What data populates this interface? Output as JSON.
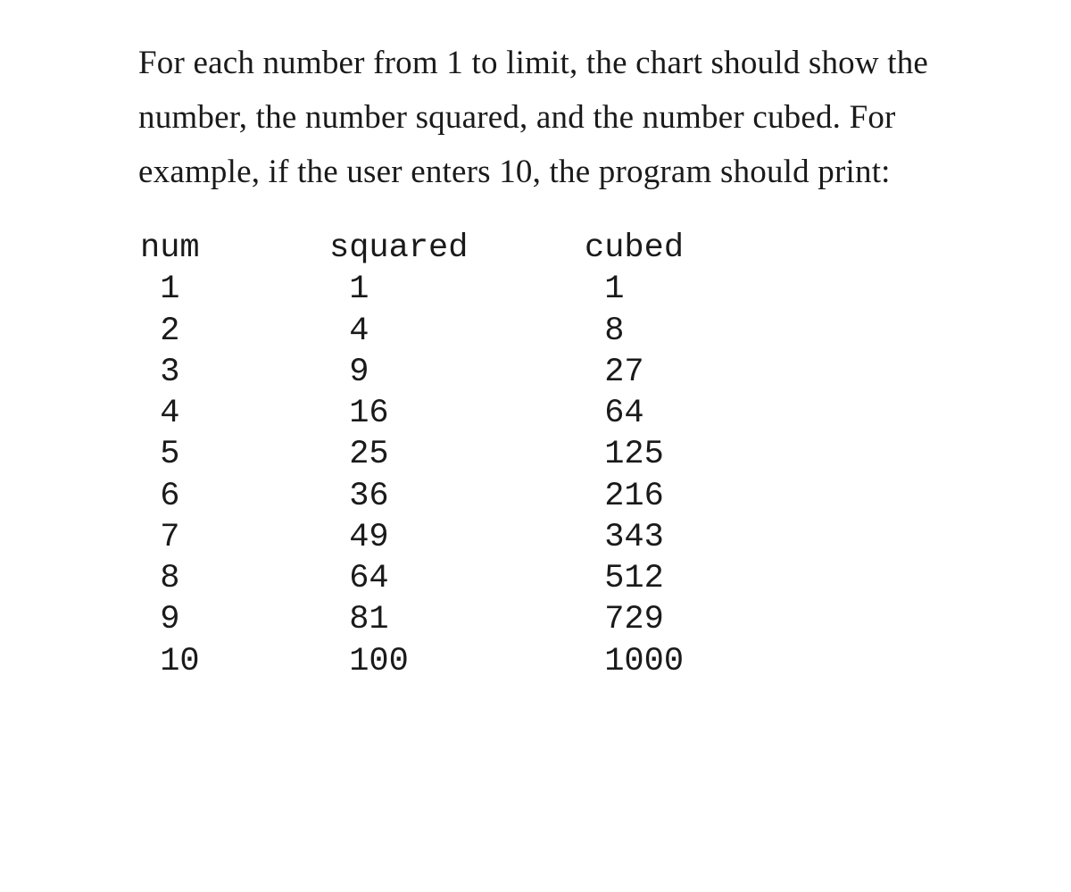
{
  "description": "For each number from 1 to limit, the chart should show the number, the number squared, and the number cubed. For example, if the user enters 10, the program should print:",
  "chart_data": {
    "type": "table",
    "headers": {
      "num": "num",
      "squared": "squared",
      "cubed": "cubed"
    },
    "rows": [
      {
        "num": "1",
        "squared": "1",
        "cubed": "1"
      },
      {
        "num": "2",
        "squared": "4",
        "cubed": "8"
      },
      {
        "num": "3",
        "squared": "9",
        "cubed": "27"
      },
      {
        "num": "4",
        "squared": "16",
        "cubed": "64"
      },
      {
        "num": "5",
        "squared": "25",
        "cubed": "125"
      },
      {
        "num": "6",
        "squared": "36",
        "cubed": "216"
      },
      {
        "num": "7",
        "squared": "49",
        "cubed": "343"
      },
      {
        "num": "8",
        "squared": "64",
        "cubed": "512"
      },
      {
        "num": "9",
        "squared": "81",
        "cubed": "729"
      },
      {
        "num": "10",
        "squared": "100",
        "cubed": "1000"
      }
    ]
  }
}
